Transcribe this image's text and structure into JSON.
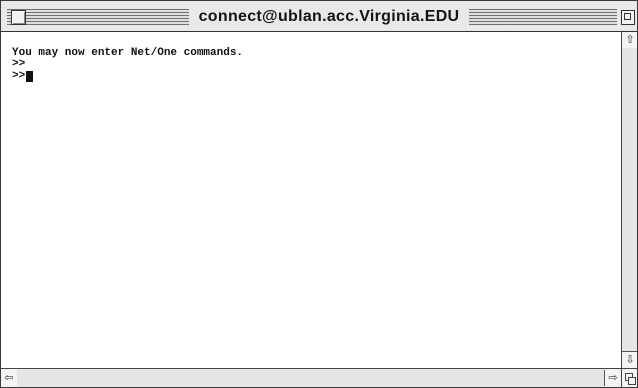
{
  "window": {
    "title": "connect@ublan.acc.Virginia.EDU"
  },
  "terminal": {
    "lines": [
      "You may now enter Net/One commands.",
      ">>",
      ">>"
    ]
  },
  "icons": {
    "close": "close-box-icon",
    "zoom": "zoom-box-icon",
    "scroll_up": "arrow-up-icon",
    "scroll_down": "arrow-down-icon",
    "scroll_left": "arrow-left-icon",
    "scroll_right": "arrow-right-icon",
    "grow": "resize-grow-icon"
  },
  "colors": {
    "window_background": "#ffffff",
    "text": "#111111"
  }
}
